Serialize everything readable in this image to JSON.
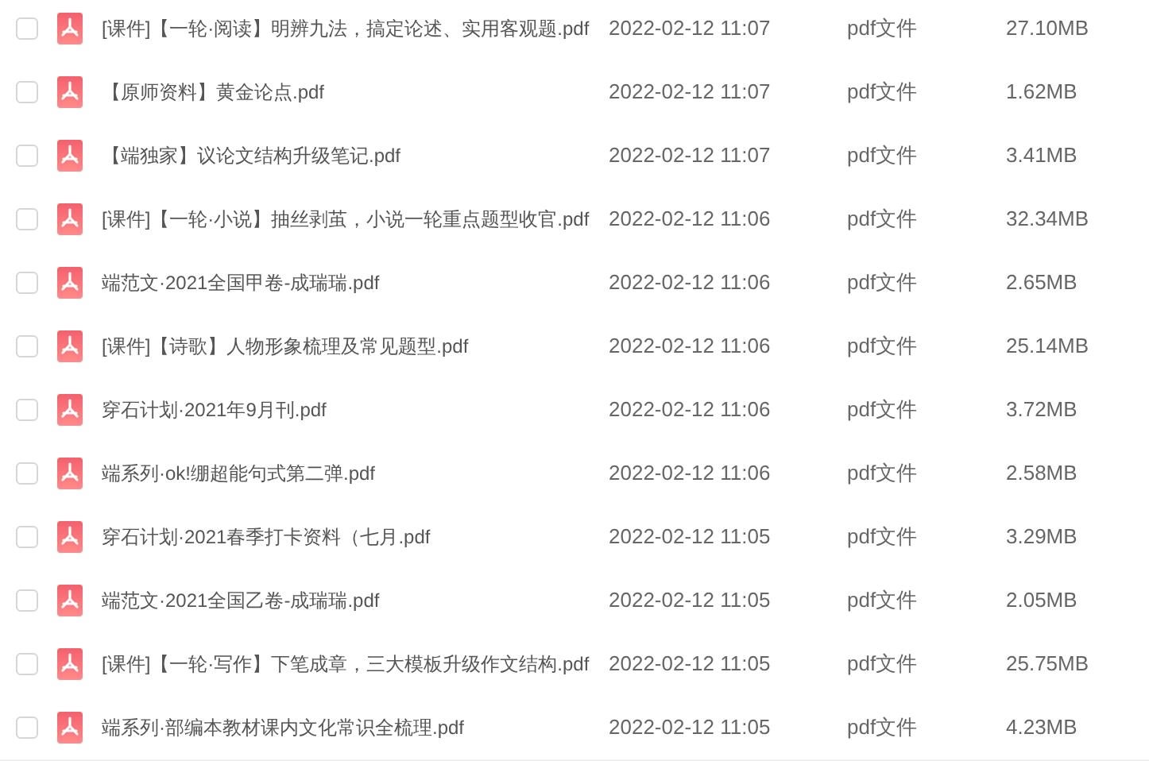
{
  "files": [
    {
      "name": "[课件]【一轮·阅读】明辨九法，搞定论述、实用客观题.pdf",
      "modified": "2022-02-12 11:07",
      "type": "pdf文件",
      "size": "27.10MB",
      "checked": false
    },
    {
      "name": "【原师资料】黄金论点.pdf",
      "modified": "2022-02-12 11:07",
      "type": "pdf文件",
      "size": "1.62MB",
      "checked": false
    },
    {
      "name": "【端独家】议论文结构升级笔记.pdf",
      "modified": "2022-02-12 11:07",
      "type": "pdf文件",
      "size": "3.41MB",
      "checked": false
    },
    {
      "name": "[课件]【一轮·小说】抽丝剥茧，小说一轮重点题型收官.pdf",
      "modified": "2022-02-12 11:06",
      "type": "pdf文件",
      "size": "32.34MB",
      "checked": false
    },
    {
      "name": "端范文·2021全国甲卷-成瑞瑞.pdf",
      "modified": "2022-02-12 11:06",
      "type": "pdf文件",
      "size": "2.65MB",
      "checked": false
    },
    {
      "name": "[课件]【诗歌】人物形象梳理及常见题型.pdf",
      "modified": "2022-02-12 11:06",
      "type": "pdf文件",
      "size": "25.14MB",
      "checked": false
    },
    {
      "name": "穿石计划·2021年9月刊.pdf",
      "modified": "2022-02-12 11:06",
      "type": "pdf文件",
      "size": "3.72MB",
      "checked": false
    },
    {
      "name": "端系列·ok!绷超能句式第二弹.pdf",
      "modified": "2022-02-12 11:06",
      "type": "pdf文件",
      "size": "2.58MB",
      "checked": false
    },
    {
      "name": "穿石计划·2021春季打卡资料（七月.pdf",
      "modified": "2022-02-12 11:05",
      "type": "pdf文件",
      "size": "3.29MB",
      "checked": false
    },
    {
      "name": "端范文·2021全国乙卷-成瑞瑞.pdf",
      "modified": "2022-02-12 11:05",
      "type": "pdf文件",
      "size": "2.05MB",
      "checked": false
    },
    {
      "name": "[课件]【一轮·写作】下笔成章，三大模板升级作文结构.pdf",
      "modified": "2022-02-12 11:05",
      "type": "pdf文件",
      "size": "25.75MB",
      "checked": false
    },
    {
      "name": "端系列·部编本教材课内文化常识全梳理.pdf",
      "modified": "2022-02-12 11:05",
      "type": "pdf文件",
      "size": "4.23MB",
      "checked": false
    }
  ]
}
